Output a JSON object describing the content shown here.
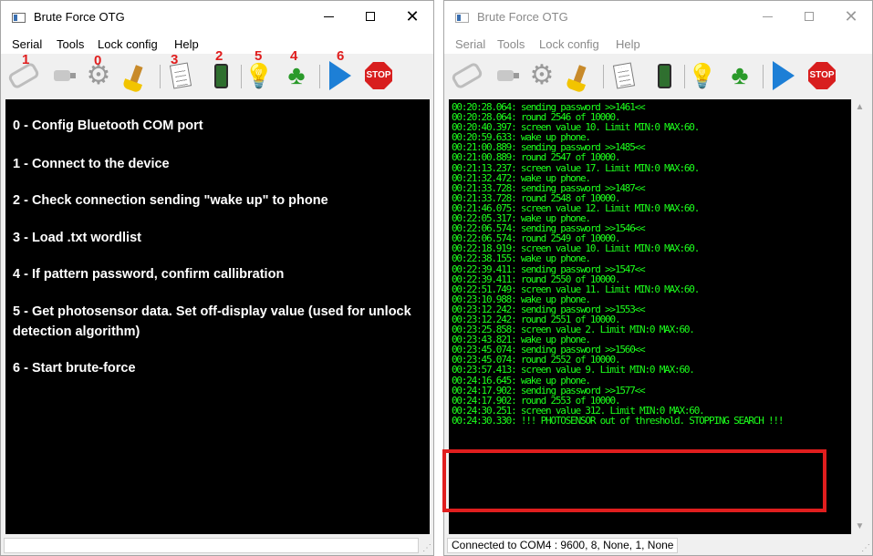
{
  "windows": [
    {
      "title": "Brute Force OTG",
      "menu": [
        "Serial",
        "Tools",
        "Lock config",
        "Help"
      ],
      "toolbar_numbers": [
        "1",
        "0",
        "3",
        "2",
        "5",
        "4",
        "6"
      ],
      "instructions": [
        "0 - Config Bluetooth COM port",
        "1 - Connect to the device",
        "2 - Check connection sending \"wake up\" to phone",
        "3 - Load .txt wordlist",
        "4 - If pattern password, confirm callibration",
        "5 - Get photosensor data. Set off-display value (used for unlock detection algorithm)",
        "6 - Start brute-force"
      ],
      "status": ""
    },
    {
      "title": "Brute Force OTG",
      "menu": [
        "Serial",
        "Tools",
        "Lock config",
        "Help"
      ],
      "log": [
        "00:20:28.064: sending password >>1461<<",
        "00:20:28.064: round 2546 of 10000.",
        "00:20:40.397: screen value 10. Limit MIN:0 MAX:60.",
        "00:20:59.633: wake up phone.",
        "00:21:00.889: sending password >>1485<<",
        "00:21:00.889: round 2547 of 10000.",
        "00:21:13.237: screen value 17. Limit MIN:0 MAX:60.",
        "00:21:32.472: wake up phone.",
        "00:21:33.728: sending password >>1487<<",
        "00:21:33.728: round 2548 of 10000.",
        "00:21:46.075: screen value 12. Limit MIN:0 MAX:60.",
        "00:22:05.317: wake up phone.",
        "00:22:06.574: sending password >>1546<<",
        "00:22:06.574: round 2549 of 10000.",
        "00:22:18.919: screen value 10. Limit MIN:0 MAX:60.",
        "00:22:38.155: wake up phone.",
        "00:22:39.411: sending password >>1547<<",
        "00:22:39.411: round 2550 of 10000.",
        "00:22:51.749: screen value 11. Limit MIN:0 MAX:60.",
        "00:23:10.988: wake up phone.",
        "00:23:12.242: sending password >>1553<<",
        "00:23:12.242: round 2551 of 10000.",
        "00:23:25.858: screen value 2. Limit MIN:0 MAX:60.",
        "00:23:43.821: wake up phone.",
        "00:23:45.074: sending password >>1560<<",
        "00:23:45.074: round 2552 of 10000.",
        "00:23:57.413: screen value 9. Limit MIN:0 MAX:60.",
        "00:24:16.645: wake up phone.",
        "00:24:17.902: sending password >>1577<<",
        "00:24:17.902: round 2553 of 10000.",
        "00:24:30.251: screen value 312. Limit MIN:0 MAX:60.",
        "00:24:30.330: !!! PHOTOSENSOR out of threshold. STOPPING SEARCH !!!"
      ],
      "status": "Connected to COM4 : 9600, 8, None, 1, None"
    }
  ],
  "icons": {
    "toolbar": [
      "chain-icon",
      "plug-icon",
      "gear-icon",
      "broom-icon",
      "wordlist-icon",
      "phone-icon",
      "bulb-icon",
      "clover-icon",
      "play-icon",
      "stop-icon"
    ],
    "stop_label": "STOP",
    "window_controls": [
      "minimize-icon",
      "maximize-icon",
      "close-icon"
    ]
  },
  "colors": {
    "console_bg": "#000000",
    "instruction_text": "#ffffff",
    "log_text": "#1cff1c",
    "annotation_red": "#e01e1e"
  }
}
